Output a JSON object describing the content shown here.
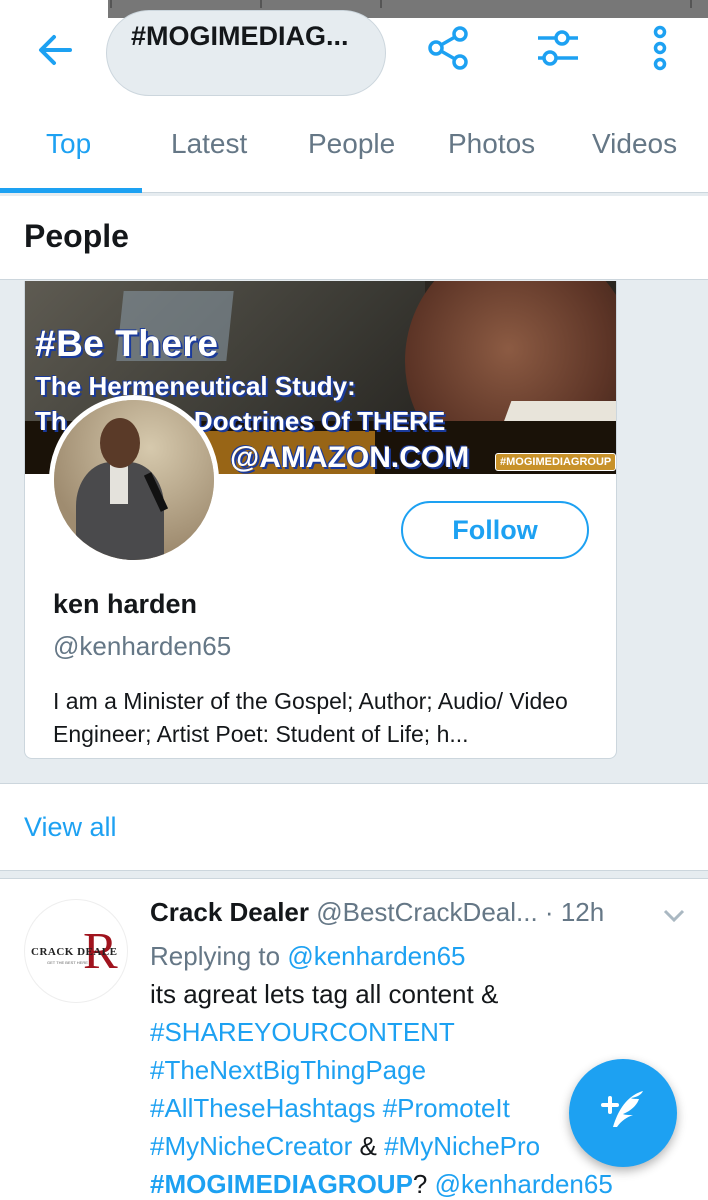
{
  "search": {
    "query": "#MOGIMEDIAG..."
  },
  "icons": {
    "back": "arrow-left-icon",
    "share": "share-icon",
    "filter": "sliders-icon",
    "more": "more-vertical-icon",
    "compose": "compose-tweet-icon",
    "caret": "chevron-down-icon"
  },
  "colors": {
    "accent": "#1da1f2",
    "text": "#14171a",
    "secondary": "#657786",
    "divider": "#ccd6dd",
    "background": "#e6ecf0"
  },
  "tabs": [
    {
      "label": "Top",
      "active": true
    },
    {
      "label": "Latest",
      "active": false
    },
    {
      "label": "People",
      "active": false
    },
    {
      "label": "Photos",
      "active": false
    },
    {
      "label": "Videos",
      "active": false
    }
  ],
  "people_section": {
    "title": "People",
    "card": {
      "banner_line1": "#Be There",
      "banner_line2": "The Hermeneutical Study:",
      "banner_line3": "Th        les & Doctrines Of THERE",
      "banner_line4": "@AMAZON.COM",
      "banner_tag": "#MOGIMEDIAGROUP",
      "follow_label": "Follow",
      "name": "ken harden",
      "handle": "@kenharden65",
      "bio": "I am a Minister of the Gospel; Author; Audio/ Video Engineer; Artist Poet: Student of Life;  h..."
    },
    "view_all": "View all"
  },
  "tweet": {
    "avatar_text": "CRACK DEALE",
    "avatar_sub": "GET THE BEST HERE",
    "avatar_letter": "R",
    "author_name": "Crack Dealer",
    "author_handle": "@BestCrackDeal...",
    "separator": " · ",
    "time": "12h",
    "replying_prefix": "Replying to ",
    "replying_handle": "@kenharden65",
    "text1": "its agreat lets tag all content &",
    "tag1": "#SHAREYOURCONTENT",
    "tag2": "#TheNextBigThingPage",
    "tag3": "#AllTheseHashtags",
    "tag4": "#PromoteIt",
    "tag5": "#MyNicheCreator",
    "amp": " & ",
    "tag6": "#MyNichePro",
    "tag7": "#MOGIMEDIAGROUP",
    "qmark": "? ",
    "mention": "@kenharden65"
  }
}
